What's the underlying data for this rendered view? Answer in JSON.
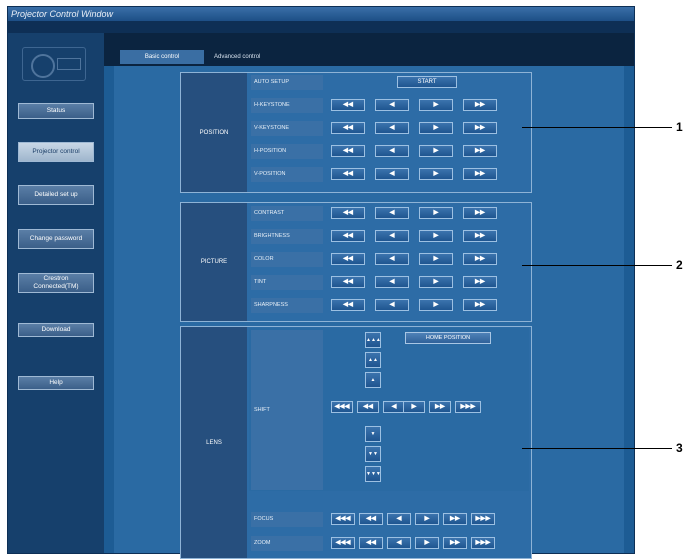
{
  "window": {
    "title": "Projector Control Window"
  },
  "sidebar": {
    "items": [
      {
        "label": "Status"
      },
      {
        "label": "Projector control"
      },
      {
        "label": "Detailed set up"
      },
      {
        "label": "Change password"
      },
      {
        "label": "Crestron Connected(TM)"
      },
      {
        "label": "Download"
      },
      {
        "label": "Help"
      }
    ],
    "active_index": 1
  },
  "tabs": [
    {
      "label": "Basic control"
    },
    {
      "label": "Advanced control"
    }
  ],
  "position": {
    "label": "POSITION",
    "auto_setup": {
      "label": "AUTO SETUP",
      "button": "START"
    },
    "rows": [
      {
        "label": "H-KEYSTONE"
      },
      {
        "label": "V-KEYSTONE"
      },
      {
        "label": "H-POSITION"
      },
      {
        "label": "V-POSITION"
      }
    ],
    "buttons": [
      "◀◀",
      "◀",
      "▶",
      "▶▶"
    ]
  },
  "picture": {
    "label": "PICTURE",
    "rows": [
      {
        "label": "CONTRAST"
      },
      {
        "label": "BRIGHTNESS"
      },
      {
        "label": "COLOR"
      },
      {
        "label": "TINT"
      },
      {
        "label": "SHARPNESS"
      }
    ],
    "buttons": [
      "◀◀",
      "◀",
      "▶",
      "▶▶"
    ]
  },
  "lens": {
    "label": "LENS",
    "shift_label": "SHIFT",
    "home_position": "HOME POSITION",
    "shift_buttons": {
      "up": [
        "▲▲▲",
        "▲▲",
        "▲"
      ],
      "down": [
        "▼",
        "▼▼",
        "▼▼▼"
      ],
      "left": [
        "◀◀◀",
        "◀◀",
        "◀"
      ],
      "right": [
        "▶",
        "▶▶",
        "▶▶▶"
      ]
    },
    "focus_label": "FOCUS",
    "zoom_label": "ZOOM",
    "row_buttons": [
      "◀◀◀",
      "◀◀",
      "◀",
      "▶",
      "▶▶",
      "▶▶▶"
    ]
  },
  "callouts": [
    "1",
    "2",
    "3"
  ]
}
